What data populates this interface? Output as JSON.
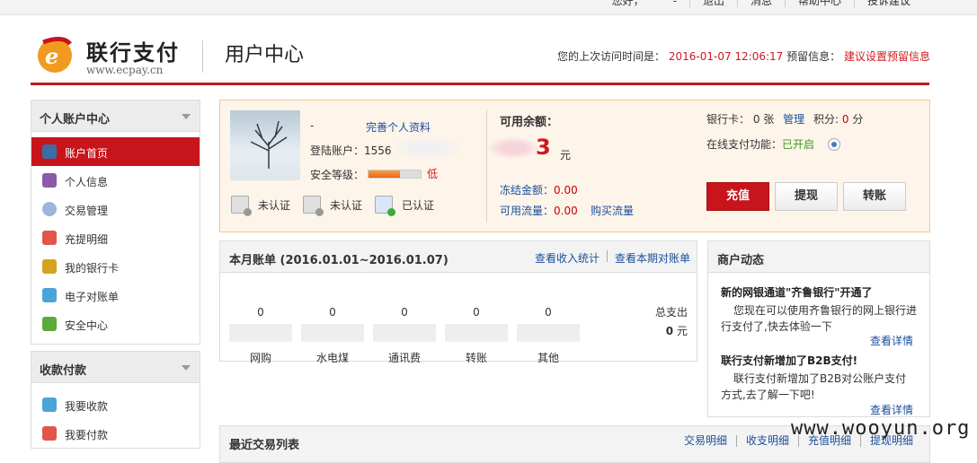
{
  "topbar": {
    "greeting": "您好，",
    "dash": "-",
    "logout": "退出",
    "messages": "消息",
    "help": "帮助中心",
    "complaint": "投诉建议"
  },
  "header": {
    "brand": "联行支付",
    "url": "www.ecpay.cn",
    "title": "用户中心",
    "last_visit_label": "您的上次访问时间是：",
    "last_visit_time": "2016-01-07 12:06:17",
    "reserve_label": "预留信息：",
    "reserve_value": "建议设置预留信息"
  },
  "sidebar": {
    "sections": [
      {
        "title": "个人账户中心",
        "items": [
          {
            "label": "账户首页",
            "icon": "user-icon",
            "active": true
          },
          {
            "label": "个人信息",
            "icon": "profile-icon"
          },
          {
            "label": "交易管理",
            "icon": "gear-icon"
          },
          {
            "label": "充提明细",
            "icon": "tag-icon"
          },
          {
            "label": "我的银行卡",
            "icon": "bank-card-icon"
          },
          {
            "label": "电子对账单",
            "icon": "statement-icon"
          },
          {
            "label": "安全中心",
            "icon": "security-icon"
          }
        ]
      },
      {
        "title": "收款付款",
        "items": [
          {
            "label": "我要收款",
            "icon": "receive-icon"
          },
          {
            "label": "我要付款",
            "icon": "pay-icon"
          }
        ]
      }
    ]
  },
  "account": {
    "name": "-",
    "complete_profile": "完善个人资料",
    "login_label": "登陆账户：",
    "login_value": "1556",
    "security_label": "安全等级：",
    "security_level": 0.6,
    "security_text": "低",
    "certs": [
      {
        "label": "未认证",
        "icon": "id-card-icon",
        "ok": false
      },
      {
        "label": "未认证",
        "icon": "certificate-icon",
        "ok": false
      },
      {
        "label": "已认证",
        "icon": "phone-icon",
        "ok": true
      }
    ],
    "balance_label": "可用余额：",
    "balance_value": "3",
    "balance_unit": "元",
    "frozen_label": "冻结金额：",
    "frozen_value": "0.00",
    "flow_label": "可用流量：",
    "flow_value": "0.00",
    "buy_flow": "购买流量",
    "cards_label": "银行卡：",
    "cards_count": "0",
    "cards_unit": "张",
    "manage": "管理",
    "points_label": "积分:",
    "points_value": "0",
    "points_unit": "分",
    "online_label": "在线支付功能：",
    "online_status": "已开启",
    "btn_recharge": "充值",
    "btn_withdraw": "提现",
    "btn_transfer": "转账"
  },
  "bill": {
    "title": "本月账单 (2016.01.01~2016.01.07)",
    "link_income": "查看收入统计",
    "link_statement": "查看本期对账单",
    "categories": [
      {
        "value": "0",
        "label": "网购"
      },
      {
        "value": "0",
        "label": "水电煤"
      },
      {
        "value": "0",
        "label": "通讯费"
      },
      {
        "value": "0",
        "label": "转账"
      },
      {
        "value": "0",
        "label": "其他"
      }
    ],
    "total_label": "总支出",
    "total_value": "0",
    "total_unit": "元"
  },
  "news": {
    "title": "商户动态",
    "items": [
      {
        "title": "新的网银通道\"齐鲁银行\"开通了",
        "body": "您现在可以使用齐鲁银行的网上银行进行支付了,快去体验一下",
        "more": "查看详情"
      },
      {
        "title": "联行支付新增加了B2B支付!",
        "body": "联行支付新增加了B2B对公账户支付方式,去了解一下吧!",
        "more": "查看详情"
      }
    ]
  },
  "recent": {
    "title": "最近交易列表",
    "links": [
      "交易明细",
      "收支明细",
      "充值明细",
      "提现明细"
    ]
  },
  "watermark": "www.wooyun.org",
  "colors": {
    "accent": "#c8141b",
    "link": "#1a4f9c",
    "status_on": "#3a9c1f"
  }
}
